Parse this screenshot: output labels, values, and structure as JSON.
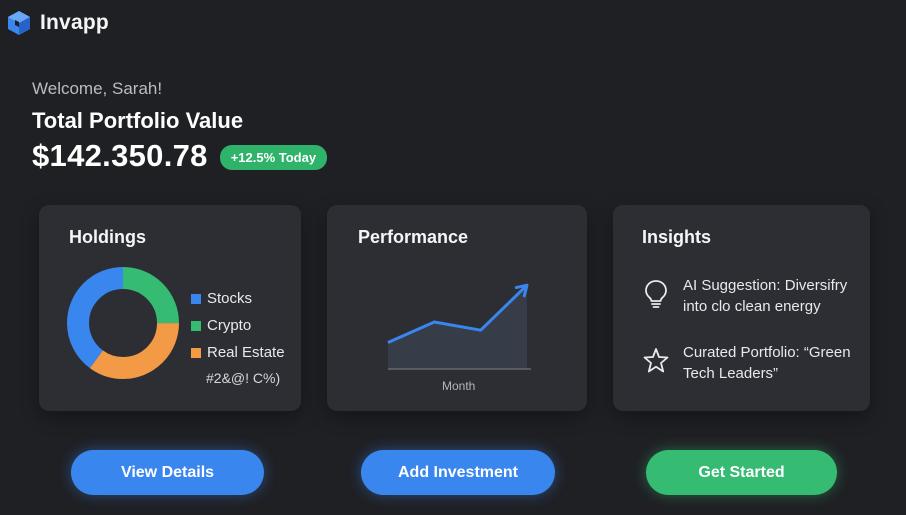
{
  "app": {
    "name": "Invapp",
    "logo_icon": "cube-logo-icon"
  },
  "hero": {
    "welcome": "Welcome, Sarah!",
    "title": "Total Portfolio Value",
    "value": "$142.350.78",
    "change_badge": "+12.5% Today"
  },
  "holdings": {
    "title": "Holdings",
    "chart_data": {
      "type": "pie",
      "style": "donut",
      "categories": [
        "Stocks",
        "Crypto",
        "Real Estate"
      ],
      "values": [
        40,
        25,
        35
      ],
      "colors": [
        "#3a86ef",
        "#35bb72",
        "#f29a45"
      ]
    },
    "legend": [
      {
        "label": "Stocks",
        "color": "#3a86ef"
      },
      {
        "label": "Crypto",
        "color": "#35bb72"
      },
      {
        "label": "Real Estate",
        "color": "#f29a45"
      }
    ],
    "legend_extra": "#2&@! C%)"
  },
  "performance": {
    "title": "Performance",
    "chart_data": {
      "type": "line",
      "xlabel": "Month",
      "ylabel": "",
      "x": [
        1,
        2,
        3,
        4
      ],
      "values": [
        30,
        55,
        45,
        100
      ],
      "ylim": [
        0,
        110
      ],
      "color": "#3a86ef",
      "fill": "area"
    }
  },
  "insights": {
    "title": "Insights",
    "items": [
      {
        "icon": "lightbulb-icon",
        "text": "AI Suggestion: Diversifry into clo clean energy"
      },
      {
        "icon": "star-icon",
        "text": "Curated Portfolio: “Green Tech Leaders”"
      }
    ]
  },
  "buttons": {
    "view_details": "View Details",
    "add_investment": "Add Investment",
    "get_started": "Get Started"
  },
  "colors": {
    "background": "#1f2024",
    "card": "#2c2e33",
    "accent_blue": "#3a86ef",
    "accent_green": "#35bb72",
    "accent_orange": "#f29a45"
  }
}
